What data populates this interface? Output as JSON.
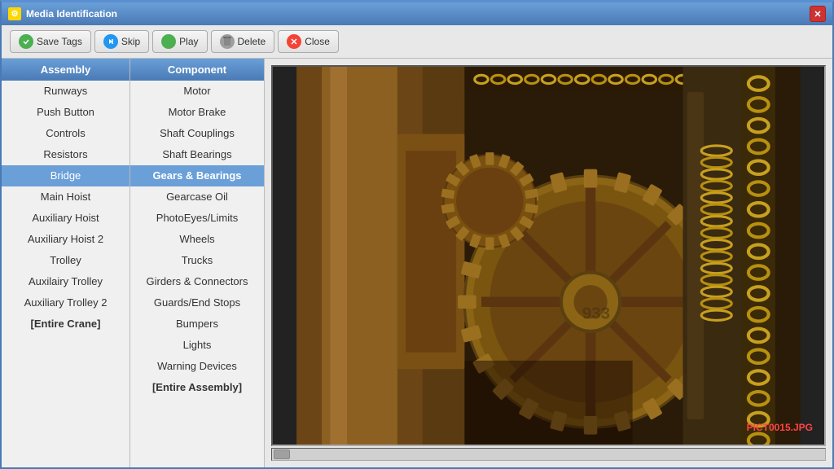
{
  "window": {
    "title": "Media Identification",
    "icon": "⚙"
  },
  "toolbar": {
    "save_tags_label": "Save Tags",
    "skip_label": "Skip",
    "play_label": "Play",
    "delete_label": "Delete",
    "close_label": "Close"
  },
  "assembly_panel": {
    "header": "Assembly",
    "items": [
      {
        "label": "Runways",
        "selected": false,
        "bold": false
      },
      {
        "label": "Push Button",
        "selected": false,
        "bold": false
      },
      {
        "label": "Controls",
        "selected": false,
        "bold": false
      },
      {
        "label": "Resistors",
        "selected": false,
        "bold": false
      },
      {
        "label": "Bridge",
        "selected": true,
        "bold": false
      },
      {
        "label": "Main Hoist",
        "selected": false,
        "bold": false
      },
      {
        "label": "Auxiliary Hoist",
        "selected": false,
        "bold": false
      },
      {
        "label": "Auxiliary Hoist 2",
        "selected": false,
        "bold": false
      },
      {
        "label": "Trolley",
        "selected": false,
        "bold": false
      },
      {
        "label": "Auxilairy Trolley",
        "selected": false,
        "bold": false
      },
      {
        "label": "Auxiliary Trolley 2",
        "selected": false,
        "bold": false
      },
      {
        "label": "[Entire Crane]",
        "selected": false,
        "bold": true
      }
    ]
  },
  "component_panel": {
    "header": "Component",
    "items": [
      {
        "label": "Motor",
        "selected": false,
        "bold": false
      },
      {
        "label": "Motor Brake",
        "selected": false,
        "bold": false
      },
      {
        "label": "Shaft Couplings",
        "selected": false,
        "bold": false
      },
      {
        "label": "Shaft Bearings",
        "selected": false,
        "bold": false
      },
      {
        "label": "Gears & Bearings",
        "selected": true,
        "bold": false
      },
      {
        "label": "Gearcase Oil",
        "selected": false,
        "bold": false
      },
      {
        "label": "PhotoEyes/Limits",
        "selected": false,
        "bold": false
      },
      {
        "label": "Wheels",
        "selected": false,
        "bold": false
      },
      {
        "label": "Trucks",
        "selected": false,
        "bold": false
      },
      {
        "label": "Girders & Connectors",
        "selected": false,
        "bold": false
      },
      {
        "label": "Guards/End Stops",
        "selected": false,
        "bold": false
      },
      {
        "label": "Bumpers",
        "selected": false,
        "bold": false
      },
      {
        "label": "Lights",
        "selected": false,
        "bold": false
      },
      {
        "label": "Warning Devices",
        "selected": false,
        "bold": false
      },
      {
        "label": "[Entire Assembly]",
        "selected": false,
        "bold": true
      }
    ]
  },
  "image": {
    "filename": "PICT0015.JPG"
  }
}
